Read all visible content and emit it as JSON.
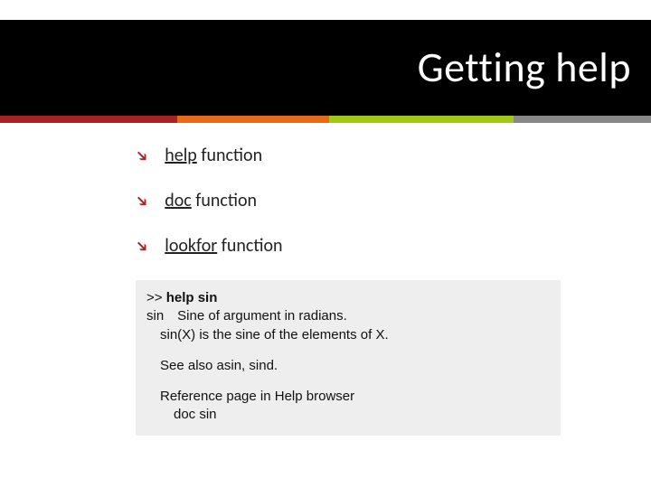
{
  "title": "Getting help",
  "bullets": [
    {
      "cmd": "help",
      "rest": " function"
    },
    {
      "cmd": "doc",
      "rest": " function"
    },
    {
      "cmd": "lookfor",
      "rest": " function"
    }
  ],
  "example": {
    "prompt": ">> ",
    "command": "help sin",
    "line1": "sin Sine of argument in radians.",
    "line2": " sin(X) is the sine of the elements of X.",
    "seealso": " See also asin, sind.",
    "ref1": " Reference page in Help browser",
    "ref2": "  doc sin"
  }
}
